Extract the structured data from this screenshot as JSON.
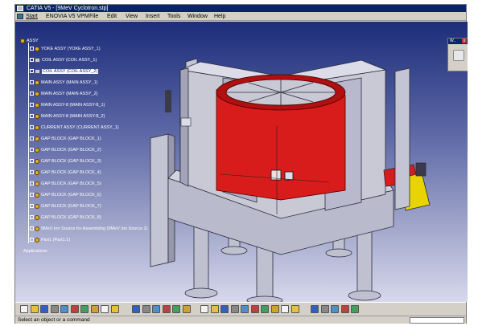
{
  "window": {
    "title": "CATIA V5 - [9MeV Cyclotron.stp]"
  },
  "menu": {
    "items": [
      "Start",
      "ENOVIA V5 VPM",
      "File",
      "Edit",
      "View",
      "Insert",
      "Tools",
      "Window",
      "Help"
    ]
  },
  "tree": {
    "root": "ASSY",
    "items": [
      {
        "label": "YOKE ASSY (YOKE ASSY_1)",
        "icon": "gear-icon"
      },
      {
        "label": "COIL ASSY (COIL ASSY_1)",
        "icon": "part-icon"
      },
      {
        "label": "COIL ASSY (COIL ASSY_2)",
        "icon": "part-icon",
        "selected": true
      },
      {
        "label": "MAIN ASSY (MAIN ASSY_1)",
        "icon": "gear-icon"
      },
      {
        "label": "MAIN ASSY (MAIN ASSY_2)",
        "icon": "gear-icon"
      },
      {
        "label": "MAIN ASSY-8 (MAIN ASSY-8_1)",
        "icon": "gear-icon"
      },
      {
        "label": "MAIN ASSY-8 (MAIN ASSY-8_2)",
        "icon": "gear-icon"
      },
      {
        "label": "CURRENT ASSY (CURRENT ASSY_1)",
        "icon": "gear-icon"
      },
      {
        "label": "GAP BLOCK (GAP BLOCK_1)",
        "icon": "gear-icon"
      },
      {
        "label": "GAP BLOCK (GAP BLOCK_2)",
        "icon": "gear-icon"
      },
      {
        "label": "GAP BLOCK (GAP BLOCK_3)",
        "icon": "gear-icon"
      },
      {
        "label": "GAP BLOCK (GAP BLOCK_4)",
        "icon": "gear-icon"
      },
      {
        "label": "GAP BLOCK (GAP BLOCK_5)",
        "icon": "gear-icon"
      },
      {
        "label": "GAP BLOCK (GAP BLOCK_6)",
        "icon": "gear-icon"
      },
      {
        "label": "GAP BLOCK (GAP BLOCK_7)",
        "icon": "gear-icon"
      },
      {
        "label": "GAP BLOCK (GAP BLOCK_8)",
        "icon": "gear-icon"
      },
      {
        "label": "9MeV Ion Source for Assembling (9MeV Ion Source.1)",
        "icon": "gear-icon"
      },
      {
        "label": "Part1 (Part1.1)",
        "icon": "gear-icon"
      }
    ],
    "footer": "Applications"
  },
  "mini_toolbar": {
    "title": "W..",
    "close": "x"
  },
  "status": {
    "text": "Select an object or a command"
  },
  "colors": {
    "viewport_top": "#1d2d7a",
    "viewport_bottom": "#d7d8ec",
    "coil": "#d81c1c",
    "model_gray": "#c9c9d6",
    "yellow_part": "#e8d400"
  },
  "toolbar_icons": [
    "new-icon",
    "open-icon",
    "save-icon",
    "print-icon",
    "cut-icon",
    "copy-icon",
    "paste-icon",
    "undo-icon",
    "redo-icon",
    "whats-this-icon",
    "formula-icon",
    "comment-icon",
    "table-icon",
    "tree-icon",
    "measure-icon",
    "catalog-icon",
    "fit-all-icon",
    "pan-icon",
    "rotate-icon",
    "zoom-in-icon",
    "zoom-out-icon",
    "normal-view-icon",
    "iso-view-icon",
    "shading-icon",
    "hide-show-icon",
    "swap-visible-icon",
    "render-icon",
    "select-icon",
    "snap-icon",
    "grid-icon",
    "misc-icon"
  ]
}
